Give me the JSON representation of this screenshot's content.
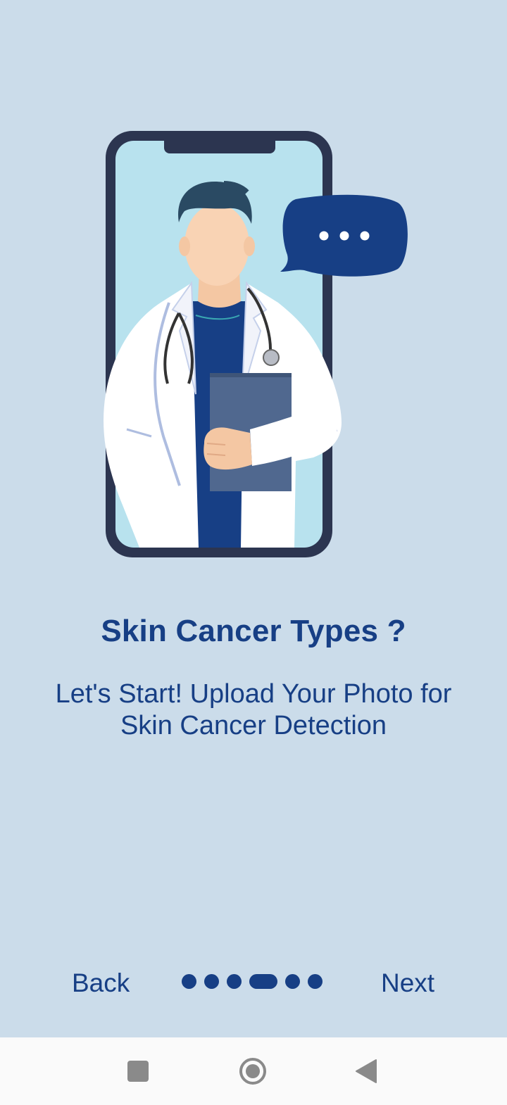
{
  "onboarding": {
    "title": "Skin Cancer Types ?",
    "subtitle_line1": "Let's Start! Upload Your Photo for",
    "subtitle_line2": "Skin Cancer Detection",
    "illustration_icon": "doctor-in-phone-with-speech-bubble",
    "page_indicator": {
      "total_pages": 6,
      "current_page": 4
    }
  },
  "navigation": {
    "back_label": "Back",
    "next_label": "Next"
  },
  "system_bar": {
    "recents_icon": "square-icon",
    "home_icon": "circle-icon",
    "back_icon": "triangle-back-icon"
  },
  "colors": {
    "background": "#cbdcea",
    "accent": "#173f85",
    "phone_frame": "#2c3550",
    "phone_screen": "#b8e2ee",
    "system_bar": "#fafafa"
  }
}
